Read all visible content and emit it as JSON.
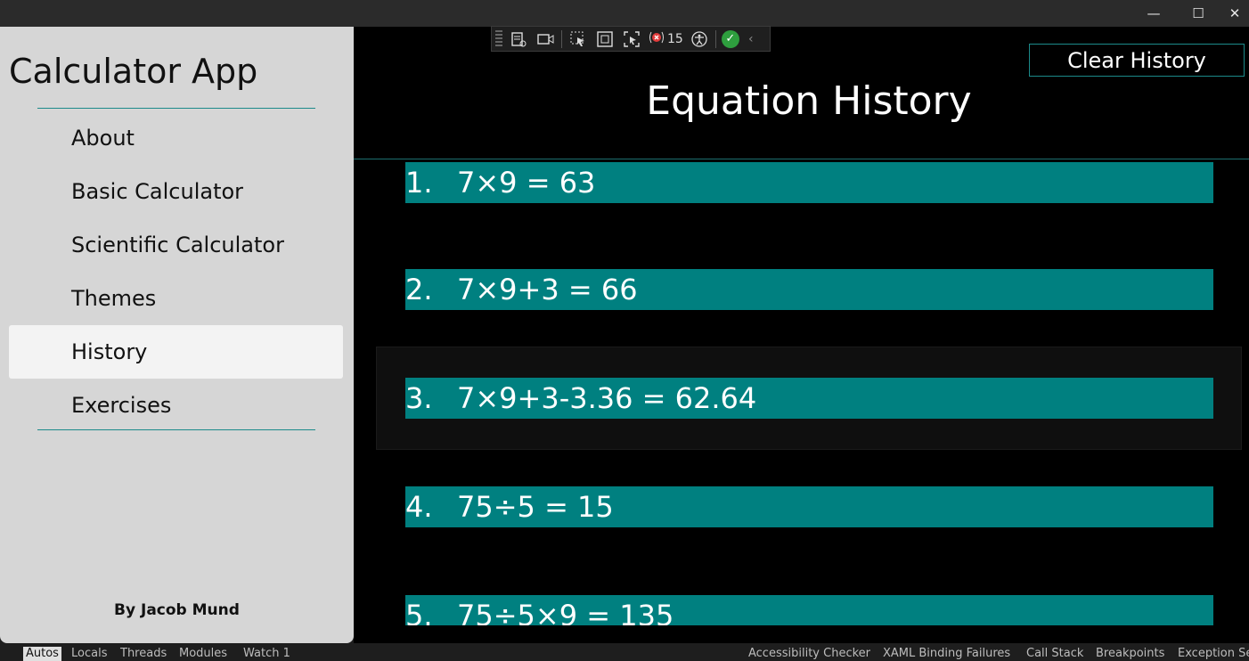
{
  "window": {
    "min_icon": "minimize-icon",
    "max_icon": "maximize-icon",
    "close_icon": "close-icon"
  },
  "sidebar": {
    "title": "Calculator App",
    "items": [
      {
        "label": "About",
        "selected": false
      },
      {
        "label": "Basic Calculator",
        "selected": false
      },
      {
        "label": "Scientific Calculator",
        "selected": false
      },
      {
        "label": "Themes",
        "selected": false
      },
      {
        "label": "History",
        "selected": true
      },
      {
        "label": "Exercises",
        "selected": false
      }
    ],
    "author": "By Jacob Mund"
  },
  "main": {
    "title": "Equation History",
    "clear_label": "Clear History",
    "equations": [
      {
        "num": "1.",
        "text": "7×9 = 63"
      },
      {
        "num": "2.",
        "text": "7×9+3 = 66"
      },
      {
        "num": "3.",
        "text": "7×9+3-3.36 = 62.64"
      },
      {
        "num": "4.",
        "text": "75÷5 = 15"
      },
      {
        "num": "5.",
        "text": "75÷5×9 = 135"
      }
    ]
  },
  "devtools": {
    "error_count": "15"
  },
  "bottom_tabs": {
    "left": [
      "Autos",
      "Locals",
      "Threads",
      "Modules",
      "Watch 1"
    ],
    "right": [
      "Accessibility Checker",
      "XAML Binding Failures",
      "Call Stack",
      "Breakpoints",
      "Exception Se"
    ]
  },
  "colors": {
    "accent": "#008080",
    "sidebar_bg": "#d6d6d6",
    "main_bg": "#000000"
  }
}
